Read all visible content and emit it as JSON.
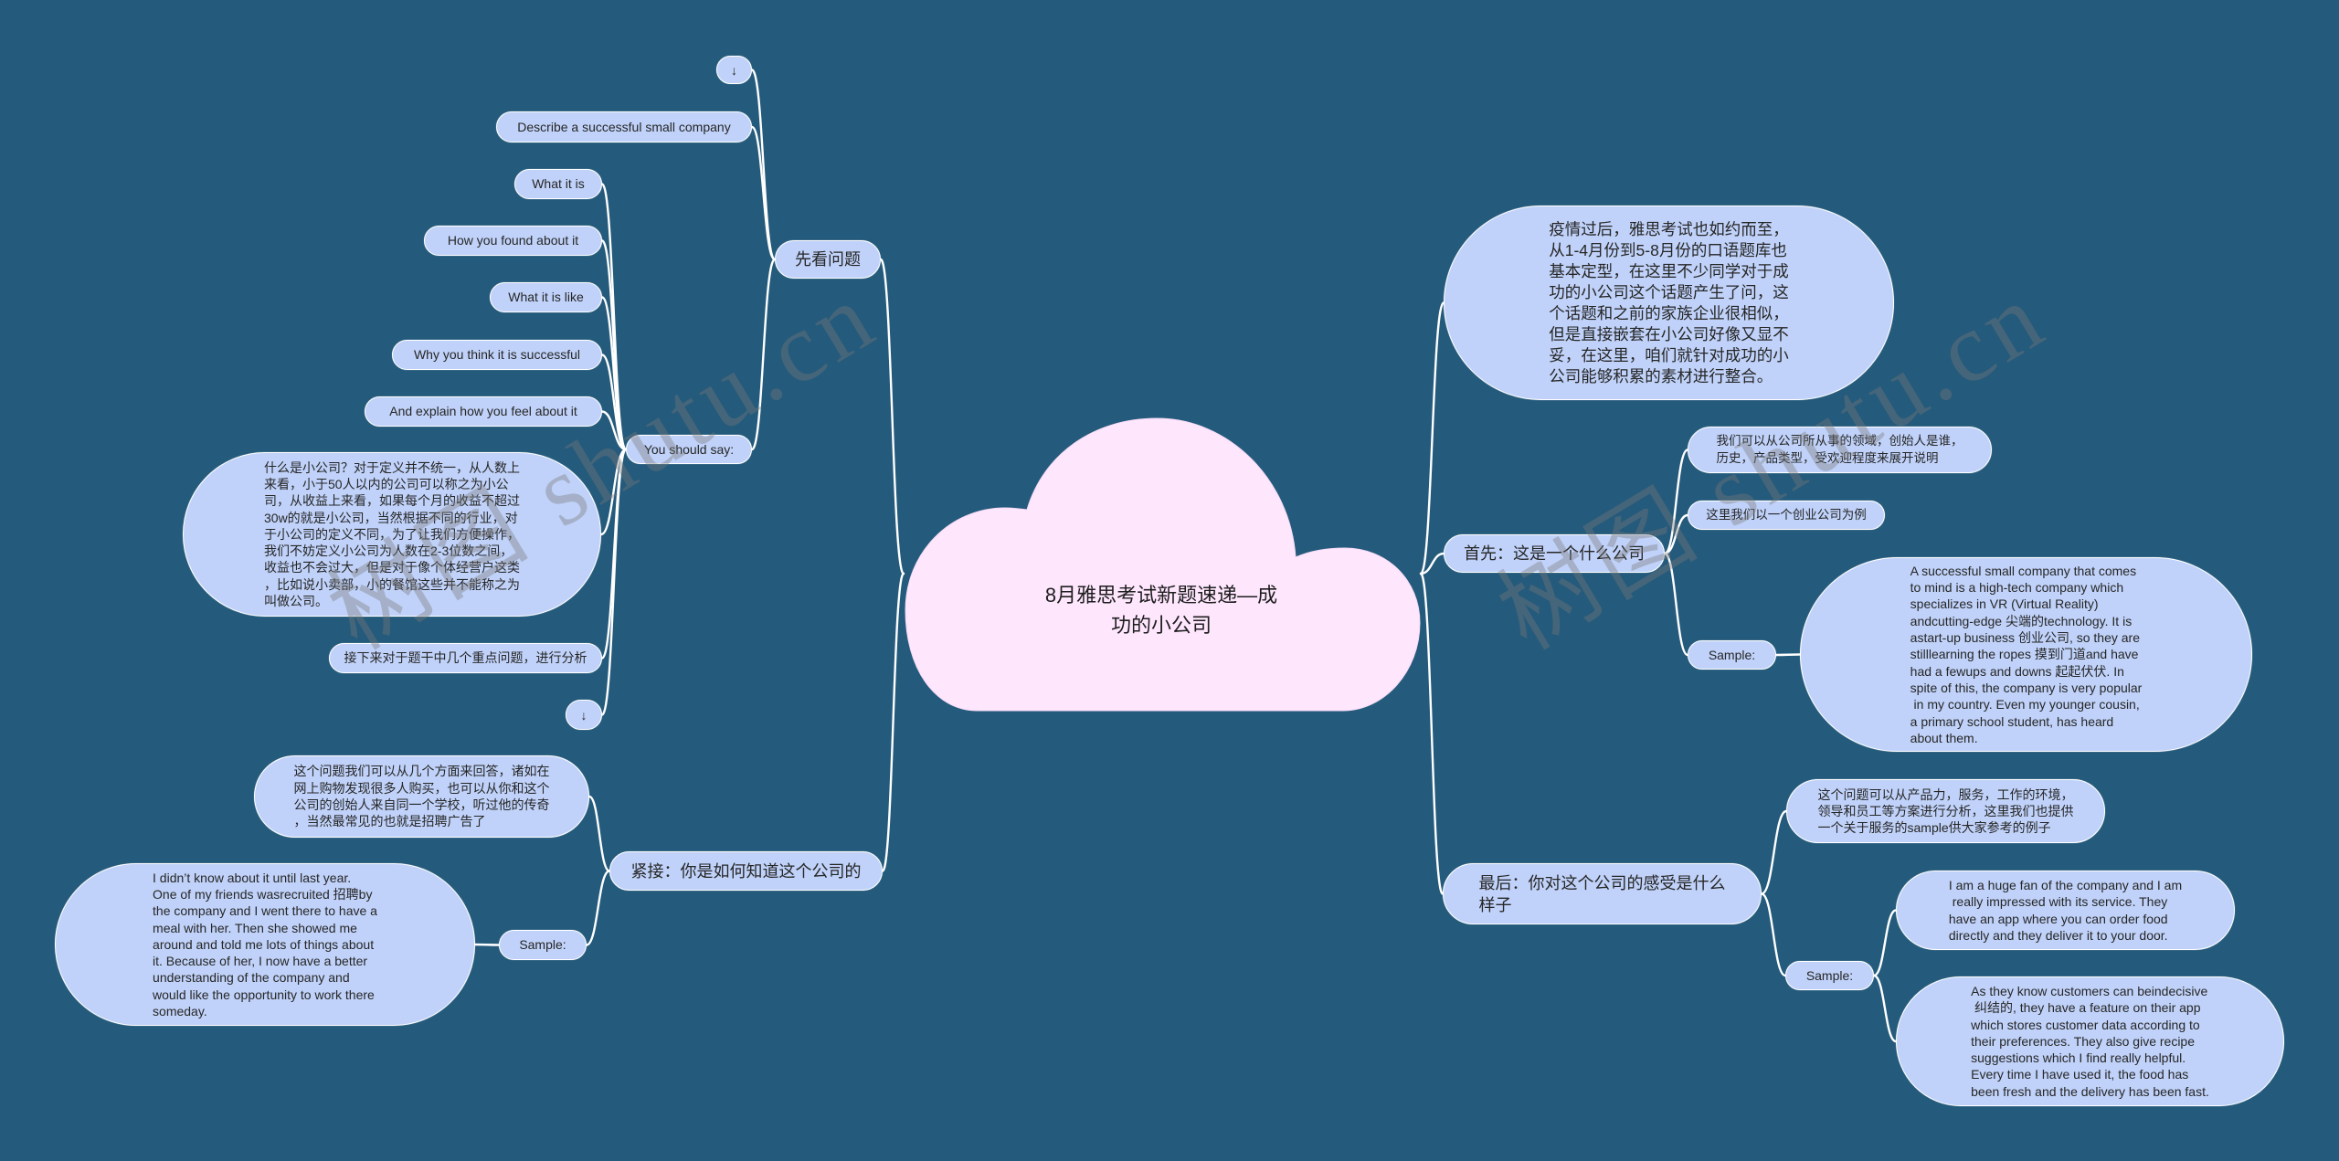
{
  "colors": {
    "background": "#245a7b",
    "node_fill": "#c0d2f9",
    "node_border": "#ffffff",
    "root_fill": "#fee6fd",
    "connector": "#ffffff",
    "text": "#262626",
    "watermark": "rgba(120,120,120,0.38)"
  },
  "watermark": "树图 shutu.cn",
  "root": {
    "label": "8月雅思考试新题速递—成\n功的小公司"
  },
  "left_branches": [
    {
      "label": "先看问题",
      "children": [
        {
          "label": "↓",
          "icon": "down-arrow-icon"
        },
        {
          "label": "Describe a successful small company"
        },
        {
          "label": "You should say:",
          "children": [
            {
              "label": "What it is"
            },
            {
              "label": "How you found about it"
            },
            {
              "label": "What it is like"
            },
            {
              "label": "Why you think it is successful"
            },
            {
              "label": "And explain how you feel about it"
            },
            {
              "label": "什么是小公司？对于定义并不统一，从人数上\n来看，小于50人以内的公司可以称之为小公\n司，从收益上来看，如果每个月的收益不超过\n30w的就是小公司，当然根据不同的行业，对\n于小公司的定义不同，为了让我们方便操作，\n我们不妨定义小公司为人数在2-3位数之间，\n收益也不会过大，但是对于像个体经营户这类\n，比如说小卖部，小的餐馆这些并不能称之为\n叫做公司。"
            },
            {
              "label": "接下来对于题干中几个重点问题，进行分析"
            },
            {
              "label": "↓",
              "icon": "down-arrow-icon"
            }
          ]
        }
      ]
    },
    {
      "label": "紧接：你是如何知道这个公司的",
      "children": [
        {
          "label": "这个问题我们可以从几个方面来回答，诸如在\n网上购物发现很多人购买，也可以从你和这个\n公司的创始人来自同一个学校，听过他的传奇\n，当然最常见的也就是招聘广告了"
        },
        {
          "label": "Sample:",
          "children": [
            {
              "label": "I didn’t know about it until last year.\nOne of my friends wasrecruited 招聘by\nthe company and I went there to have a\nmeal with her. Then she showed me\naround and told me lots of things about\nit. Because of her, I now have a better\nunderstanding of the company and\nwould like the opportunity to work there\nsomeday."
            }
          ]
        }
      ]
    }
  ],
  "right_branches": [
    {
      "label": "疫情过后，雅思考试也如约而至，\n从1-4月份到5-8月份的口语题库也\n基本定型，在这里不少同学对于成\n功的小公司这个话题产生了问，这\n个话题和之前的家族企业很相似，\n但是直接嵌套在小公司好像又显不\n妥，在这里，咱们就针对成功的小\n公司能够积累的素材进行整合。"
    },
    {
      "label": "首先：这是一个什么公司",
      "children": [
        {
          "label": "我们可以从公司所从事的领域，创始人是谁，\n历史，产品类型，受欢迎程度来展开说明"
        },
        {
          "label": "这里我们以一个创业公司为例"
        },
        {
          "label": "Sample:",
          "children": [
            {
              "label": "A successful small company that comes\nto mind is a high-tech company which\nspecializes in VR (Virtual Reality)\nandcutting-edge 尖端的technology. It is\nastart-up business 创业公司, so they are\nstilllearning the ropes 摸到门道and have\nhad a fewups and downs 起起伏伏. In\nspite of this, the company is very popular\n in my country. Even my younger cousin,\na primary school student, has heard\nabout them."
            }
          ]
        }
      ]
    },
    {
      "label": "最后：你对这个公司的感受是什么\n样子",
      "children": [
        {
          "label": "这个问题可以从产品力，服务，工作的环境，\n领导和员工等方案进行分析，这里我们也提供\n一个关于服务的sample供大家参考的例子"
        },
        {
          "label": "Sample:",
          "children": [
            {
              "label": "I am a huge fan of the company and I am\n really impressed with its service. They\nhave an app where you can order food\ndirectly and they deliver it to your door."
            },
            {
              "label": "As they know customers can beindecisive\n 纠结的, they have a feature on their app\nwhich stores customer data according to\ntheir preferences. They also give recipe\nsuggestions which I find really helpful.\nEvery time I have used it, the food has\nbeen fresh and the delivery has been fast."
            }
          ]
        }
      ]
    }
  ]
}
